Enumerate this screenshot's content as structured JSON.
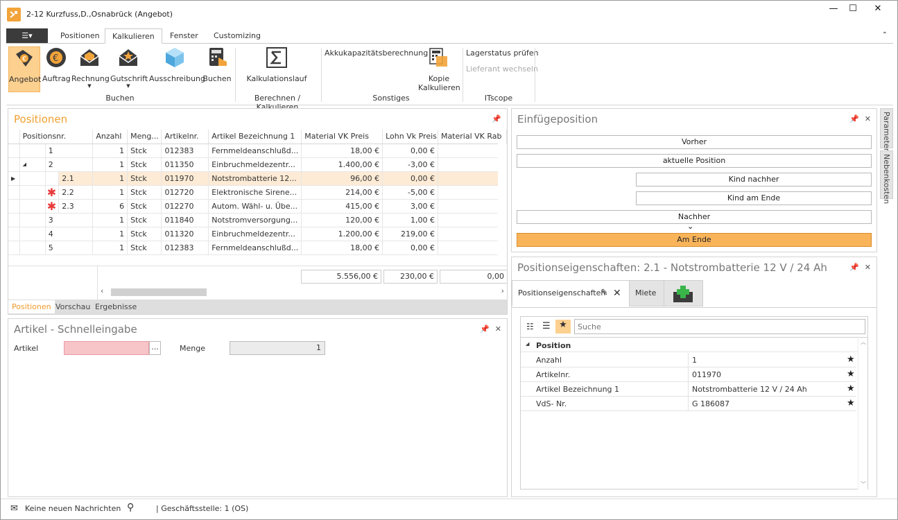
{
  "window": {
    "title": "2-12 Kurzfuss,D.,Osnabrück (Angebot)",
    "minimize": "—",
    "maximize": "☐",
    "close": "✕"
  },
  "menu": {
    "file_icon": "☰▾",
    "tabs": [
      "Positionen",
      "Kalkulieren",
      "Fenster",
      "Customizing"
    ],
    "active_tab": "Kalkulieren",
    "collapse": "⌃"
  },
  "ribbon": {
    "buchen": {
      "label": "Buchen",
      "buttons": [
        "Angebot",
        "Auftrag",
        "Rechnung",
        "Gutschrift",
        "Ausschreibung",
        "Buchen"
      ]
    },
    "berechnen": {
      "label": "Berechnen / Kalkulieren",
      "button": "Kalkulationslauf"
    },
    "sonstiges": {
      "label": "Sonstiges",
      "link": "Akkukapazitätsberechnung",
      "button_line1": "Kopie",
      "button_line2": "Kalkulieren"
    },
    "itscope": {
      "label": "ITscope",
      "link1": "Lagerstatus prüfen",
      "link2": "Lieferant wechseln"
    }
  },
  "positionen": {
    "title": "Positionen",
    "columns": [
      "Positionsnr.",
      "Anzahl",
      "Meng...",
      "Artikelnr.",
      "Artikel Bezeichnung 1",
      "Material VK Preis",
      "Lohn Vk Preis",
      "Material VK Rab"
    ],
    "rows": [
      {
        "pos": "1",
        "anzahl": "1",
        "menge": "Stck",
        "artnr": "012383",
        "bez": "Fernmeldeanschlußd...",
        "mat": "18,00 €",
        "lohn": "0,00 €"
      },
      {
        "pos": "2",
        "anzahl": "1",
        "menge": "Stck",
        "artnr": "011350",
        "bez": "Einbruchmeldezentr...",
        "mat": "1.400,00 €",
        "lohn": "-3,00 €"
      },
      {
        "pos": "2.1",
        "anzahl": "1",
        "menge": "Stck",
        "artnr": "011970",
        "bez": "Notstrombatterie 12...",
        "mat": "96,00 €",
        "lohn": "0,00 €"
      },
      {
        "pos": "2.2",
        "anzahl": "1",
        "menge": "Stck",
        "artnr": "012720",
        "bez": "Elektronische Sirene...",
        "mat": "214,00 €",
        "lohn": "-5,00 €"
      },
      {
        "pos": "2.3",
        "anzahl": "6",
        "menge": "Stck",
        "artnr": "012270",
        "bez": "Autom. Wähl- u. Übe...",
        "mat": "415,00 €",
        "lohn": "3,00 €"
      },
      {
        "pos": "3",
        "anzahl": "1",
        "menge": "Stck",
        "artnr": "011840",
        "bez": "Notstromversorgung...",
        "mat": "120,00 €",
        "lohn": "1,00 €"
      },
      {
        "pos": "4",
        "anzahl": "1",
        "menge": "Stck",
        "artnr": "011320",
        "bez": "Einbruchmeldezentr...",
        "mat": "1.200,00 €",
        "lohn": "219,00 €"
      },
      {
        "pos": "5",
        "anzahl": "1",
        "menge": "Stck",
        "artnr": "012383",
        "bez": "Fernmeldeanschlußd...",
        "mat": "18,00 €",
        "lohn": "0,00 €"
      }
    ],
    "totals": {
      "mat": "5.556,00 €",
      "lohn": "230,00 €",
      "rab": "0,00"
    },
    "bottom_tabs": [
      "Positionen",
      "Vorschau",
      "Ergebnisse"
    ]
  },
  "schnelleingabe": {
    "title": "Artikel - Schnelleingabe",
    "artikel_label": "Artikel",
    "artikel_value": "",
    "ellipsis": "...",
    "menge_label": "Menge",
    "menge_value": "1"
  },
  "einfuege": {
    "title": "Einfügeposition",
    "buttons": {
      "vorher": "Vorher",
      "aktuelle": "aktuelle Position",
      "kind_nachher": "Kind nachher",
      "kind_ende": "Kind am Ende",
      "nachher": "Nachher",
      "am_ende": "Am Ende"
    }
  },
  "side_tabs": [
    "Parameter",
    "Nebenkosten"
  ],
  "eigenschaften": {
    "title": "Positionseigenschaften: 2.1 - Notstrombatterie 12 V / 24 Ah",
    "tabs": [
      "Positionseigenschaften",
      "Miete"
    ],
    "search_placeholder": "Suche",
    "category": "Position",
    "rows": [
      {
        "key": "Anzahl",
        "value": "1"
      },
      {
        "key": "Artikelnr.",
        "value": "011970"
      },
      {
        "key": "Artikel Bezeichnung 1",
        "value": "Notstrombatterie 12 V / 24 Ah"
      },
      {
        "key": "VdS- Nr.",
        "value": "G 186087"
      }
    ]
  },
  "status": {
    "messages": "Keine neuen Nachrichten",
    "branch": "| Geschäftsstelle:  1 (OS)"
  },
  "colors": {
    "accent": "#f0a030",
    "selected_row": "#fdebd5",
    "am_ende_bg": "#f9b45a",
    "error_field": "#f7c4c8"
  }
}
